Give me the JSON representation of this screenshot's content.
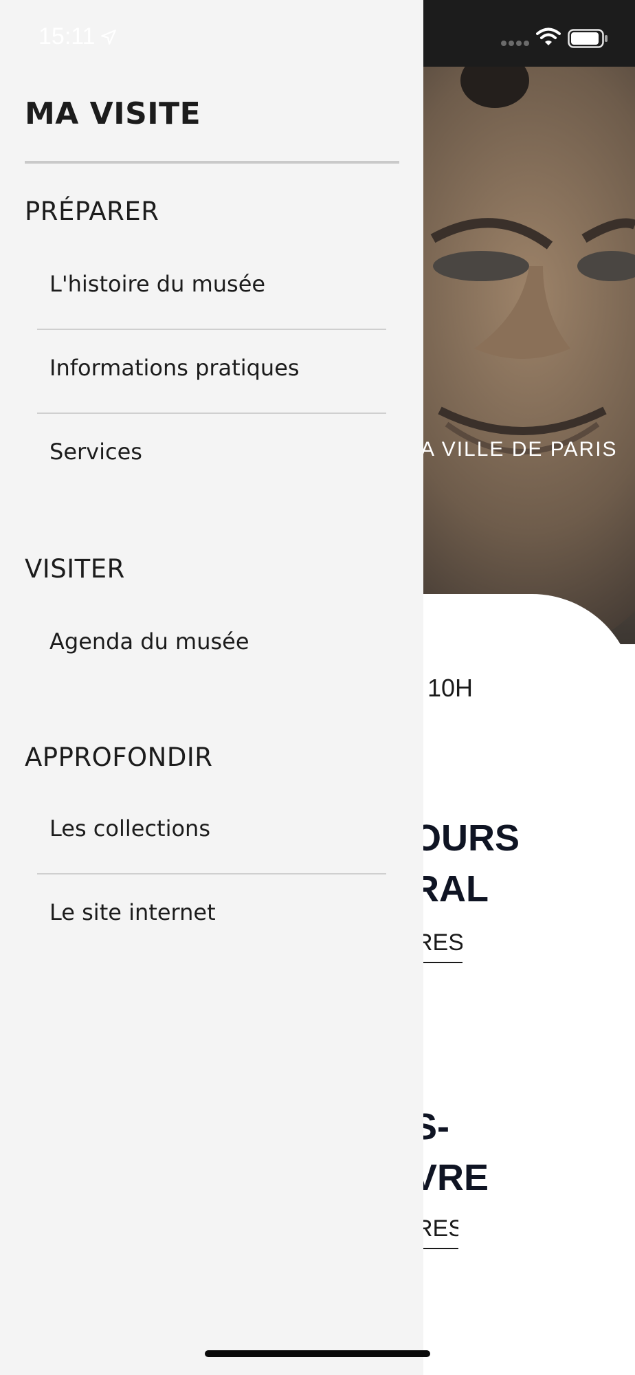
{
  "status_bar": {
    "time": "15:11"
  },
  "background": {
    "hero_caption": "A VILLE DE PARIS",
    "hours_text": "10H",
    "card1": {
      "title_line1": "OURS",
      "title_line2": "RAL",
      "link": "RES"
    },
    "card2": {
      "title_line1": "S-",
      "title_line2": "VRE",
      "link": "RES"
    }
  },
  "drawer": {
    "title": "MA VISITE",
    "sections": [
      {
        "heading": "PRÉPARER",
        "items": [
          {
            "label": "L'histoire du musée"
          },
          {
            "label": "Informations pratiques"
          },
          {
            "label": "Services"
          }
        ]
      },
      {
        "heading": "VISITER",
        "items": [
          {
            "label": "Agenda du musée"
          }
        ]
      },
      {
        "heading": "APPROFONDIR",
        "items": [
          {
            "label": "Les collections"
          },
          {
            "label": "Le site internet"
          }
        ]
      }
    ]
  },
  "colors": {
    "drawer_bg": "#f4f4f4",
    "text": "#1c1c1c",
    "divider": "#cfcfcf",
    "status_bar_bg": "#1c1c1c"
  }
}
